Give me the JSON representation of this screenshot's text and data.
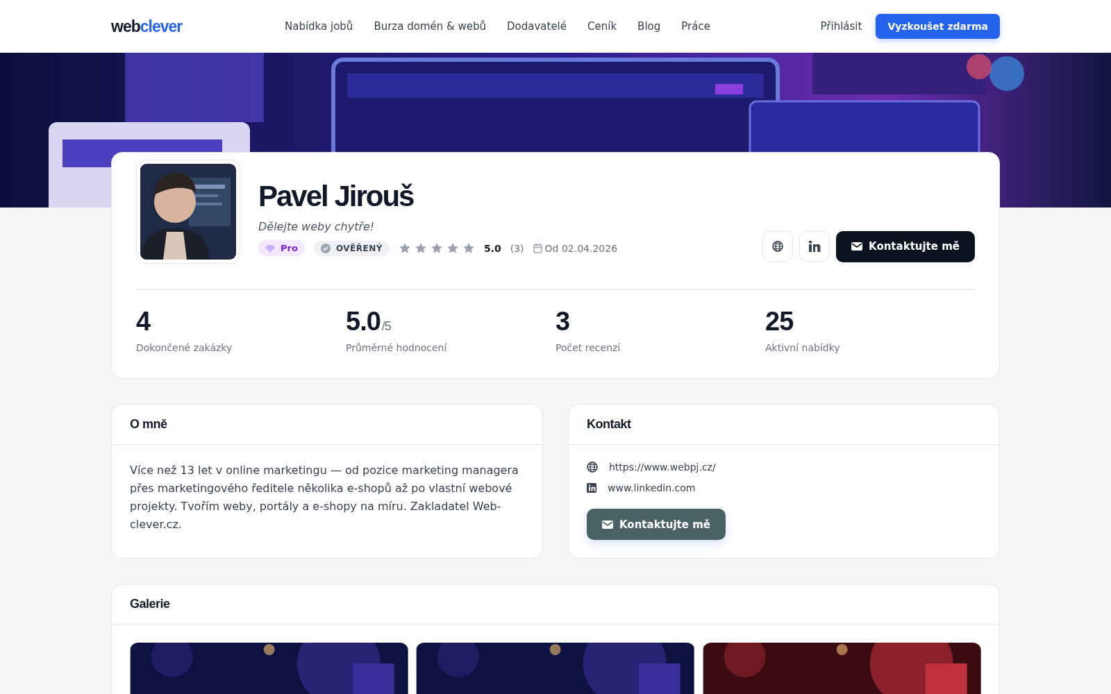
{
  "header": {
    "logo": {
      "part_1": "web",
      "part_2": "clever"
    },
    "nav": [
      {
        "label": "Nabídka jobů"
      },
      {
        "label": "Burza domén & webů"
      },
      {
        "label": "Dodavatelé"
      },
      {
        "label": "Ceník"
      },
      {
        "label": "Blog"
      },
      {
        "label": "Práce"
      }
    ],
    "login": "Přihlásit",
    "cta": "Vyzkoušet zdarma"
  },
  "profile": {
    "name": "Pavel Jirouš",
    "tagline": "Dělejte weby chytře!",
    "badges": [
      {
        "kind": "pro",
        "label": "Pro"
      },
      {
        "kind": "verified",
        "label": "OVĚŘENÝ"
      }
    ],
    "stars": 5,
    "rating": "5.0",
    "review_count": "(3)",
    "since": "Od 02.04.2026",
    "links": [
      {
        "kind": "web"
      },
      {
        "kind": "linkedin"
      }
    ],
    "contact_button": "Kontaktujte mě",
    "stats": [
      {
        "value": "4",
        "label": "Dokončené zakázky"
      },
      {
        "value": "5.0",
        "suffix": "/5",
        "label": "Průměrné hodnocení"
      },
      {
        "value": "3",
        "label": "Počet recenzí"
      },
      {
        "value": "25",
        "label": "Aktivní nabídky"
      }
    ]
  },
  "about": {
    "title": "O mně",
    "text": "Více než 13 let v online marketingu — od pozice marketing managera přes marketingového ředitele několika e-shopů až po vlastní webové projekty. Tvořím weby, portály a e-shopy na míru. Zakladatel Web-clever.cz."
  },
  "contact": {
    "title": "Kontakt",
    "items": [
      {
        "kind": "web",
        "text": "https://www.webpj.cz/"
      },
      {
        "kind": "linkedin",
        "text": "www.linkedin.com"
      }
    ],
    "button": "Kontaktujte mě"
  },
  "gallery": {
    "title": "Galerie"
  }
}
